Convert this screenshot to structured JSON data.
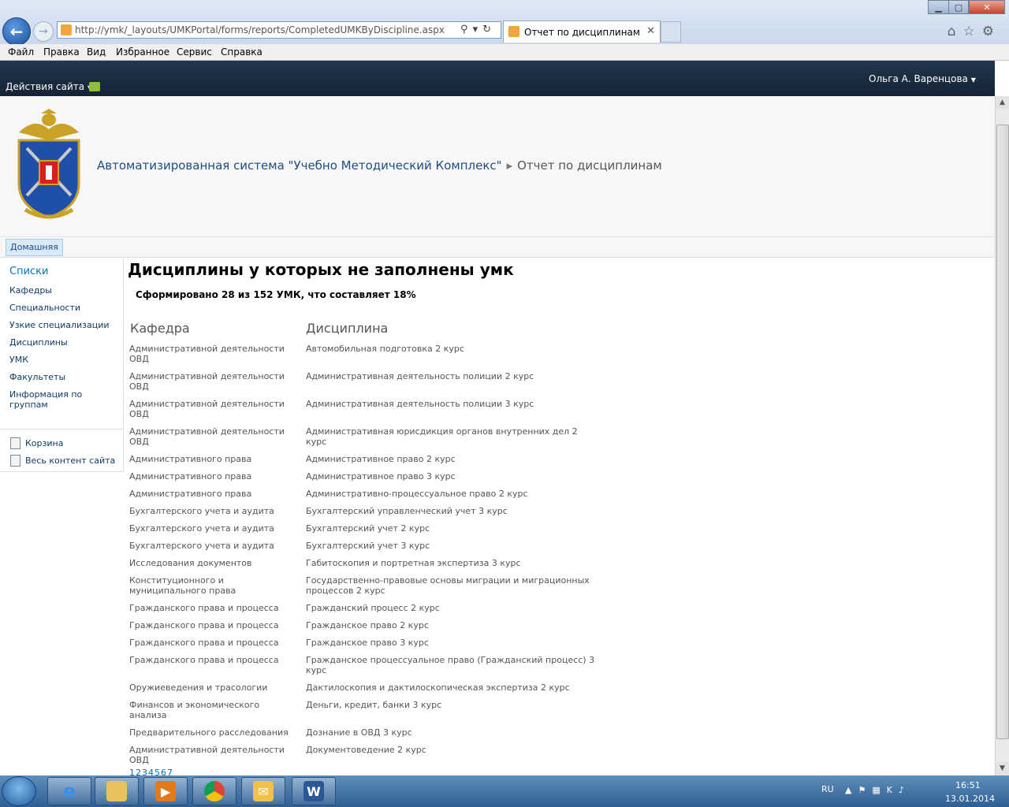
{
  "browser": {
    "url": "http://ymk/_layouts/UMKPortal/forms/reports/CompletedUMKByDiscipline.aspx",
    "tab_title": "Отчет по дисциплинам",
    "menu": [
      "Файл",
      "Правка",
      "Вид",
      "Избранное",
      "Сервис",
      "Справка"
    ]
  },
  "sharepoint": {
    "site_actions": "Действия сайта",
    "user": "Ольга А. Варенцова",
    "site_title": "Автоматизированная система \"Учебно Методический Комплекс\"",
    "page_name": "Отчет по дисциплинам",
    "home_tab": "Домашняя",
    "quicklaunch": {
      "header": "Списки",
      "items": [
        "Кафедры",
        "Специальности",
        "Узкие специализации",
        "Дисциплины",
        "УМК",
        "Факультеты",
        "Информация по группам"
      ],
      "bottom_items": [
        "Корзина",
        "Весь контент сайта"
      ]
    }
  },
  "report": {
    "title": "Дисциплины у которых не заполнены умк",
    "summary": "Сформировано 28 из 152 УМК, что составляет 18%",
    "columns": [
      "Кафедра",
      "Дисциплина"
    ],
    "rows": [
      {
        "dept": "Административной деятельности ОВД",
        "discipline": "Автомобильная подготовка 2 курс"
      },
      {
        "dept": "Административной деятельности ОВД",
        "discipline": "Административная деятельность полиции 2 курс"
      },
      {
        "dept": "Административной деятельности ОВД",
        "discipline": "Административная деятельность полиции 3 курс"
      },
      {
        "dept": "Административной деятельности ОВД",
        "discipline": "Административная юрисдикция органов внутренних дел 2 курс"
      },
      {
        "dept": "Административного права",
        "discipline": "Административное право 2 курс"
      },
      {
        "dept": "Административного права",
        "discipline": "Административное право 3 курс"
      },
      {
        "dept": "Административного права",
        "discipline": "Административно-процессуальное право 2 курс"
      },
      {
        "dept": "Бухгалтерского учета и аудита",
        "discipline": "Бухгалтерский управленческий учет 3 курс"
      },
      {
        "dept": "Бухгалтерского учета и аудита",
        "discipline": "Бухгалтерский учет 2 курс"
      },
      {
        "dept": "Бухгалтерского учета и аудита",
        "discipline": "Бухгалтерский учет 3 курс"
      },
      {
        "dept": "Исследования документов",
        "discipline": "Габитоскопия и портретная экспертиза 3 курс"
      },
      {
        "dept": "Конституционного и муниципального права",
        "discipline": "Государственно-правовые основы миграции и миграционных процессов 2 курс"
      },
      {
        "dept": "Гражданского права и процесса",
        "discipline": "Гражданский процесс 2 курс"
      },
      {
        "dept": "Гражданского права и процесса",
        "discipline": "Гражданское право 2 курс"
      },
      {
        "dept": "Гражданского права и процесса",
        "discipline": "Гражданское право 3 курс"
      },
      {
        "dept": "Гражданского права и процесса",
        "discipline": "Гражданское процессуальное право (Гражданский процесс) 3 курс"
      },
      {
        "dept": "Оружиеведения и трасологии",
        "discipline": "Дактилоскопия и дактилоскопическая экспертиза 2 курс"
      },
      {
        "dept": "Финансов и экономического анализа",
        "discipline": "Деньги, кредит, банки 3 курс"
      },
      {
        "dept": "Предварительного расследования",
        "discipline": "Дознание в ОВД 3 курс"
      },
      {
        "dept": "Административной деятельности ОВД",
        "discipline": "Документоведение 2 курс"
      }
    ],
    "pager": "1234567"
  },
  "taskbar": {
    "lang": "RU",
    "time": "16:51",
    "date": "13.01.2014"
  }
}
